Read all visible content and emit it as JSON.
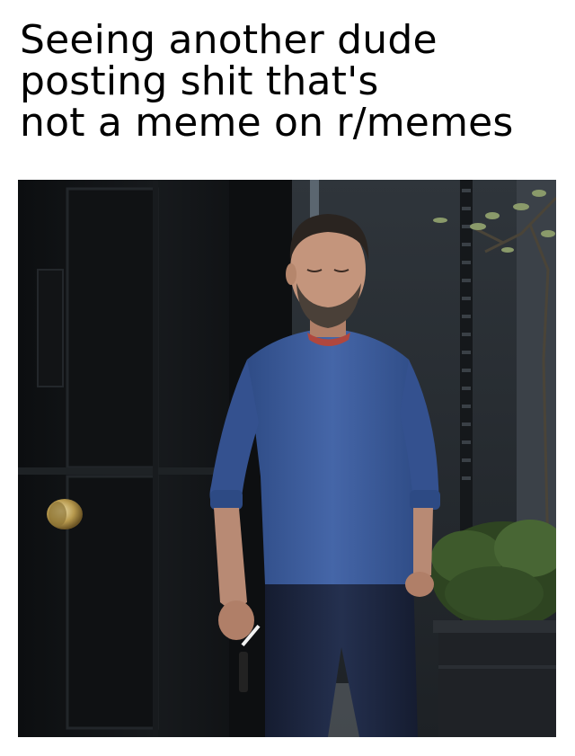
{
  "caption": {
    "lines": [
      "Seeing another dude",
      "posting shit that's",
      "not a meme on r/memes"
    ]
  },
  "photo": {
    "description_colors": {
      "door": "#111315",
      "wall": "#2b3035",
      "sweater": "#3a5a9a",
      "jeans": "#1c2540",
      "skin": "#b88a74",
      "hair": "#2a2420",
      "plant": "#3e5a2c",
      "planter": "#1f2226",
      "door_knob": "#b89a4e"
    }
  }
}
